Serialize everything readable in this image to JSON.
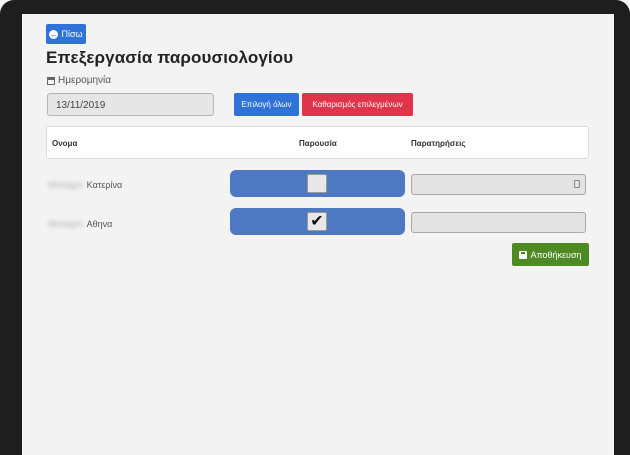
{
  "back_button": {
    "icon": "arrow-left-circle-icon",
    "label": "Πίσω"
  },
  "page_title": "Επεξεργασία παρουσιολογίου",
  "date": {
    "icon": "calendar-icon",
    "label": "Ημερομηνία",
    "value": "13/11/2019"
  },
  "actions": {
    "select_all": "Επιλογή όλων",
    "clear_selected": "Καθαρισμός επιλεγμένων"
  },
  "table": {
    "headers": {
      "name": "Ονομα",
      "presence": "Παρουσία",
      "notes": "Παρατηρήσεις"
    },
    "rows": [
      {
        "surname_blurred": "Μπλαμπ",
        "first_name": "Κατερίνα",
        "present": false,
        "notes": ""
      },
      {
        "surname_blurred": "Μπλαμπ",
        "first_name": "Αθηνα",
        "present": true,
        "notes": ""
      }
    ]
  },
  "save_button": {
    "icon": "floppy-disk-icon",
    "label": "Αποθήκευση"
  },
  "colors": {
    "primary": "#2f73d9",
    "danger": "#e0344a",
    "success": "#4e8a24",
    "presence_bg": "#4f78c2"
  }
}
